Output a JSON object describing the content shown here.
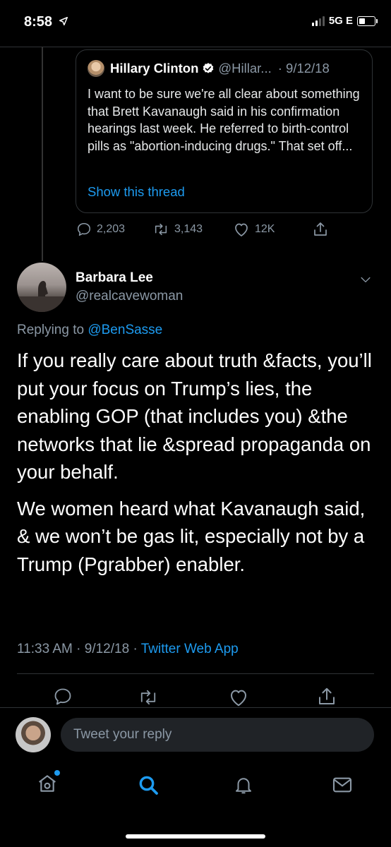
{
  "status_bar": {
    "time": "8:58",
    "network": "5G E"
  },
  "quoted_tweet": {
    "name": "Hillary Clinton",
    "handle": "@Hillar...",
    "date": "· 9/12/18",
    "text": "I want to be sure we're all clear about something that Brett Kavanaugh said in his confirmation hearings last week. He referred to birth-control pills as \"abortion-inducing drugs.\" That set off...",
    "show_thread": "Show this thread",
    "stats": {
      "replies": "2,203",
      "retweets": "3,143",
      "likes": "12K"
    }
  },
  "tweet": {
    "name": "Barbara Lee",
    "handle": "@realcavewoman",
    "replying_to_label": "Replying to",
    "replying_to_handle": "@BenSasse",
    "paragraphs": [
      "If you really care about truth &facts, you’ll put your focus on Trump’s lies, the enabling GOP (that includes you) &the networks that lie &spread propaganda on your behalf.",
      "We women heard what Kavanaugh said, & we won’t be gas lit, especially not by a Trump (Pgrabber) enabler."
    ],
    "time": "11:33 AM",
    "date": "9/12/18",
    "separator": "·",
    "source": "Twitter Web App"
  },
  "reply_box": {
    "placeholder": "Tweet your reply"
  },
  "tab_bar": {
    "items": [
      "home",
      "search",
      "notifications",
      "messages"
    ]
  },
  "colors": {
    "accent": "#1d9bf0",
    "muted": "#8b98a5",
    "divider": "#2f3336",
    "background": "#000000"
  }
}
